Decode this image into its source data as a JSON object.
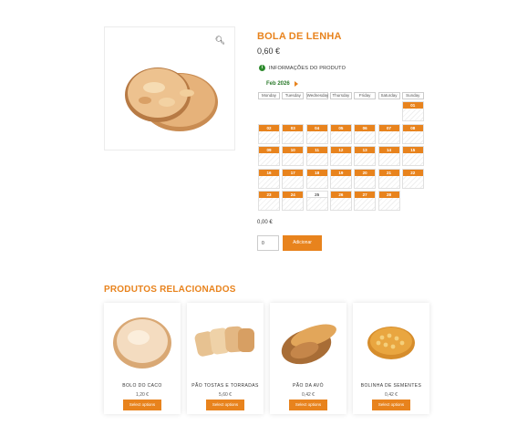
{
  "product": {
    "title": "BOLA DE LENHA",
    "price": "0,60 €",
    "info_label": "INFORMAÇÕES DO PRODUTO",
    "zoom_icon": "search-icon"
  },
  "calendar": {
    "month": "Feb 2026",
    "weekdays": [
      "Monday",
      "Tuesday",
      "Wednesday",
      "Thursday",
      "Friday",
      "Saturday",
      "Sunday"
    ],
    "days": [
      {
        "n": "01",
        "available": true
      },
      {
        "n": "02",
        "available": true
      },
      {
        "n": "03",
        "available": true
      },
      {
        "n": "04",
        "available": true
      },
      {
        "n": "05",
        "available": true
      },
      {
        "n": "06",
        "available": true
      },
      {
        "n": "07",
        "available": true
      },
      {
        "n": "08",
        "available": true
      },
      {
        "n": "09",
        "available": true
      },
      {
        "n": "10",
        "available": true
      },
      {
        "n": "11",
        "available": true
      },
      {
        "n": "12",
        "available": true
      },
      {
        "n": "13",
        "available": true
      },
      {
        "n": "14",
        "available": true
      },
      {
        "n": "15",
        "available": true
      },
      {
        "n": "16",
        "available": true
      },
      {
        "n": "17",
        "available": true
      },
      {
        "n": "18",
        "available": true
      },
      {
        "n": "19",
        "available": true
      },
      {
        "n": "20",
        "available": true
      },
      {
        "n": "21",
        "available": true
      },
      {
        "n": "22",
        "available": true
      },
      {
        "n": "23",
        "available": true
      },
      {
        "n": "24",
        "available": true
      },
      {
        "n": "25",
        "available": false
      },
      {
        "n": "26",
        "available": true
      },
      {
        "n": "27",
        "available": true
      },
      {
        "n": "28",
        "available": true
      }
    ]
  },
  "order": {
    "total": "0,00 €",
    "quantity": "0",
    "add_label": "Adicionar"
  },
  "related": {
    "title": "PRODUTOS RELACIONADOS",
    "items": [
      {
        "name": "BOLO DO CACO",
        "price": "1,20 €",
        "button": "Select options"
      },
      {
        "name": "PÃO TOSTAS E TORRADAS",
        "price": "5,60 €",
        "button": "Select options"
      },
      {
        "name": "PÃO DA AVÓ",
        "price": "0,42 €",
        "button": "Select options"
      },
      {
        "name": "BOLINHA DE SEMENTES",
        "price": "0,42 €",
        "button": "Select options"
      }
    ]
  },
  "colors": {
    "accent": "#e8831d",
    "info": "#2e8b2e",
    "month": "#2b7a2b"
  }
}
